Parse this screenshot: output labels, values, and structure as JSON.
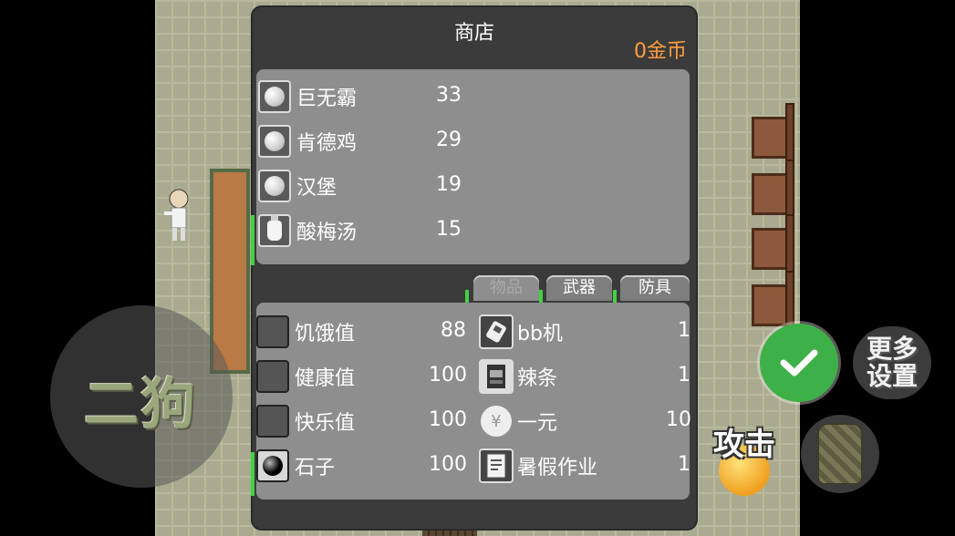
{
  "shop": {
    "title": "商店",
    "coins": "0金币",
    "items": [
      {
        "name": "巨无霸",
        "price": "33",
        "icon": "pearl-icon"
      },
      {
        "name": "肯德鸡",
        "price": "29",
        "icon": "pearl-icon"
      },
      {
        "name": "汉堡",
        "price": "19",
        "icon": "pearl-icon"
      },
      {
        "name": "酸梅汤",
        "price": "15",
        "icon": "bottle-icon"
      }
    ]
  },
  "tabs": [
    {
      "label": "物品",
      "active": true
    },
    {
      "label": "武器",
      "active": false
    },
    {
      "label": "防具",
      "active": false
    }
  ],
  "stats": [
    {
      "name": "饥饿值",
      "value": "88"
    },
    {
      "name": "健康值",
      "value": "100"
    },
    {
      "name": "快乐值",
      "value": "100"
    },
    {
      "name": "石子",
      "value": "100"
    }
  ],
  "inventory": [
    {
      "name": "bb机",
      "count": "1",
      "icon": "pager-icon"
    },
    {
      "name": "辣条",
      "count": "1",
      "icon": "snack-icon"
    },
    {
      "name": "一元",
      "count": "10",
      "icon": "coin-icon",
      "symbol": "¥"
    },
    {
      "name": "暑假作业",
      "count": "1",
      "icon": "homework-icon"
    }
  ],
  "player": {
    "name": "二狗"
  },
  "controls": {
    "settings_line1": "更多",
    "settings_line2": "设置",
    "attack_label": "攻击"
  },
  "colors": {
    "coins": "#ff9f3d",
    "confirm": "#3eb048",
    "panel": "#8e8e8e"
  }
}
